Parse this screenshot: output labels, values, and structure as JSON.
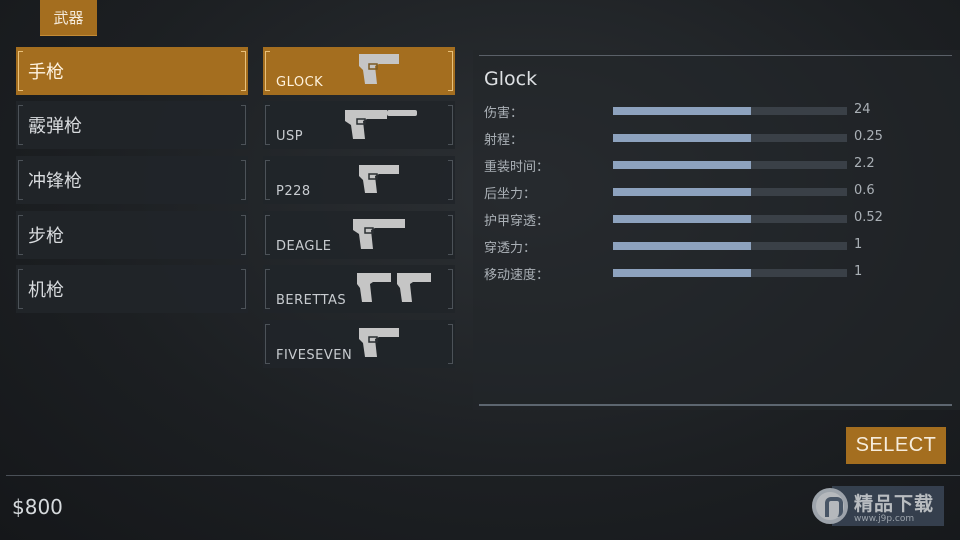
{
  "top_tab": {
    "label": "武器"
  },
  "categories": [
    {
      "label": "手枪",
      "active": true
    },
    {
      "label": "霰弹枪",
      "active": false
    },
    {
      "label": "冲锋枪",
      "active": false
    },
    {
      "label": "步枪",
      "active": false
    },
    {
      "label": "机枪",
      "active": false
    }
  ],
  "weapons": [
    {
      "label": "GLOCK",
      "icon": "pistol-icon",
      "active": true
    },
    {
      "label": "USP",
      "icon": "silenced-pistol-icon",
      "active": false
    },
    {
      "label": "P228",
      "icon": "pistol-icon",
      "active": false
    },
    {
      "label": "DEAGLE",
      "icon": "pistol-icon",
      "active": false
    },
    {
      "label": "BERETTAS",
      "icon": "dual-pistols-icon",
      "active": false
    },
    {
      "label": "FIVESEVEN",
      "icon": "pistol-icon",
      "active": false
    }
  ],
  "stats": {
    "weapon_name": "Glock",
    "rows": [
      {
        "label": "伤害：",
        "value": "24",
        "fill_percent": 59
      },
      {
        "label": "射程：",
        "value": "0.25",
        "fill_percent": 59
      },
      {
        "label": "重装时间：",
        "value": "2.2",
        "fill_percent": 59
      },
      {
        "label": "后坐力：",
        "value": "0.6",
        "fill_percent": 59
      },
      {
        "label": "护甲穿透：",
        "value": "0.52",
        "fill_percent": 59
      },
      {
        "label": "穿透力：",
        "value": "1",
        "fill_percent": 59
      },
      {
        "label": "移动速度：",
        "value": "1",
        "fill_percent": 59
      }
    ]
  },
  "select_button": {
    "label": "SELECT"
  },
  "money": "$800",
  "watermark": {
    "text": "精品下载",
    "url": "www.j9p.com"
  },
  "colors": {
    "accent": "#a46e1f",
    "stat_fill": "#8da2be",
    "stat_track": "#3a4047"
  }
}
